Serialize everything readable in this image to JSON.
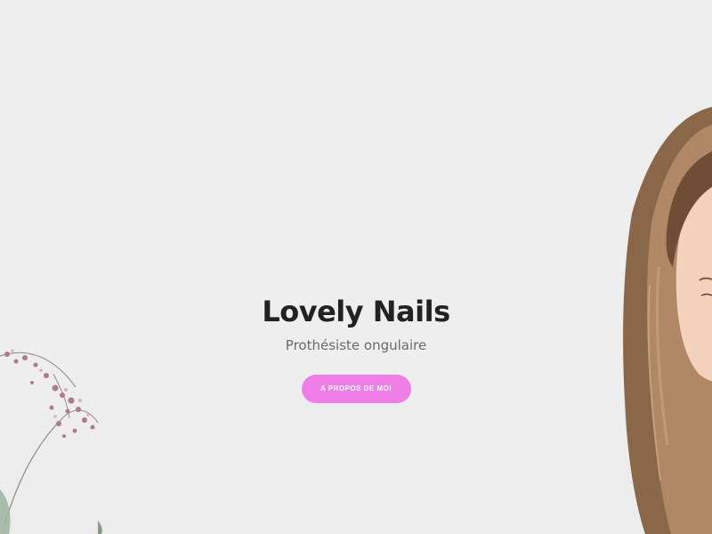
{
  "hero": {
    "title": "Lovely Nails",
    "subtitle": "Prothésiste ongulaire",
    "cta_label": "A PROPOS DE MOI"
  },
  "colors": {
    "background": "#eeeeee",
    "title": "#222222",
    "subtitle": "#6b6b6b",
    "cta_background": "#ef7ee9",
    "cta_text": "#ffffff"
  }
}
